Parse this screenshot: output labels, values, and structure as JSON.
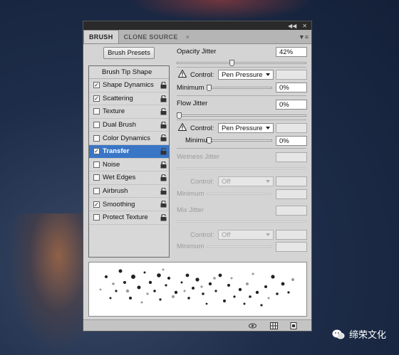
{
  "panel": {
    "tabs": [
      "BRUSH",
      "CLONE SOURCE"
    ],
    "titlebar_icons": [
      "collapse-icon",
      "close-icon"
    ],
    "brush_presets_button": "Brush Presets",
    "list_header": "Brush Tip Shape",
    "options": [
      {
        "label": "Shape Dynamics",
        "checked": true,
        "selected": false
      },
      {
        "label": "Scattering",
        "checked": true,
        "selected": false
      },
      {
        "label": "Texture",
        "checked": false,
        "selected": false
      },
      {
        "label": "Dual Brush",
        "checked": false,
        "selected": false
      },
      {
        "label": "Color Dynamics",
        "checked": false,
        "selected": false
      },
      {
        "label": "Transfer",
        "checked": true,
        "selected": true
      },
      {
        "label": "Noise",
        "checked": false,
        "selected": false
      },
      {
        "label": "Wet Edges",
        "checked": false,
        "selected": false
      },
      {
        "label": "Airbrush",
        "checked": false,
        "selected": false
      },
      {
        "label": "Smoothing",
        "checked": true,
        "selected": false
      },
      {
        "label": "Protect Texture",
        "checked": false,
        "selected": false
      }
    ]
  },
  "transfer": {
    "opacity_jitter": {
      "label": "Opacity Jitter",
      "value": "42%",
      "level": 0.42
    },
    "opacity_control": {
      "label": "Control:",
      "value": "Pen Pressure"
    },
    "opacity_minimum": {
      "label": "Minimum",
      "value": "0%",
      "level": 0
    },
    "flow_jitter": {
      "label": "Flow Jitter",
      "value": "0%",
      "level": 0
    },
    "flow_control": {
      "label": "Control:",
      "value": "Pen Pressure"
    },
    "flow_minimum": {
      "label": "Minimum",
      "value": "0%",
      "level": 0
    },
    "wetness_jitter": {
      "label": "Wetness Jitter"
    },
    "wetness_control": {
      "label": "Control:",
      "value": "Off"
    },
    "wetness_minimum": {
      "label": "Minimum"
    },
    "mix_jitter": {
      "label": "Mix Jitter"
    },
    "mix_control": {
      "label": "Control:",
      "value": "Off"
    },
    "mix_minimum": {
      "label": "Minimum"
    }
  },
  "footer_icons": [
    "brush-eye-icon",
    "grid-icon",
    "new-preset-icon"
  ],
  "watermark": "缔荣文化",
  "colors": {
    "selected": "#3a76c6",
    "panel": "#d4d4d4"
  }
}
